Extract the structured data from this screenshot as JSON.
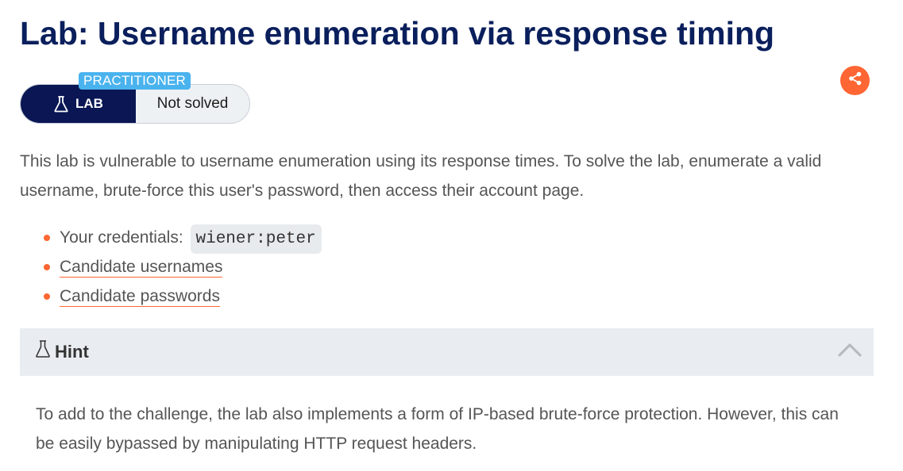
{
  "page": {
    "title": "Lab: Username enumeration via response timing"
  },
  "badge": {
    "level": "PRACTITIONER",
    "type_label": "LAB",
    "status": "Not solved",
    "type_icon": "flask-icon"
  },
  "share": {
    "icon": "share-icon",
    "color": "#ff6633"
  },
  "description": "This lab is vulnerable to username enumeration using its response times. To solve the lab, enumerate a valid username, brute-force this user's password, then access their account page.",
  "info": {
    "credentials_label": "Your credentials:",
    "credentials_value": "wiener:peter",
    "links": [
      "Candidate usernames",
      "Candidate passwords"
    ]
  },
  "hint": {
    "title": "Hint",
    "icon": "flask-icon",
    "toggle_icon": "chevron-up-icon",
    "body": "To add to the challenge, the lab also implements a form of IP-based brute-force protection. However, this can be easily bypassed by manipulating HTTP request headers."
  },
  "colors": {
    "title": "#0a1f5c",
    "lab_badge": "#0a1754",
    "level_tag": "#4ab3ee",
    "accent": "#ff6633",
    "hint_bg": "#e9edf1"
  }
}
